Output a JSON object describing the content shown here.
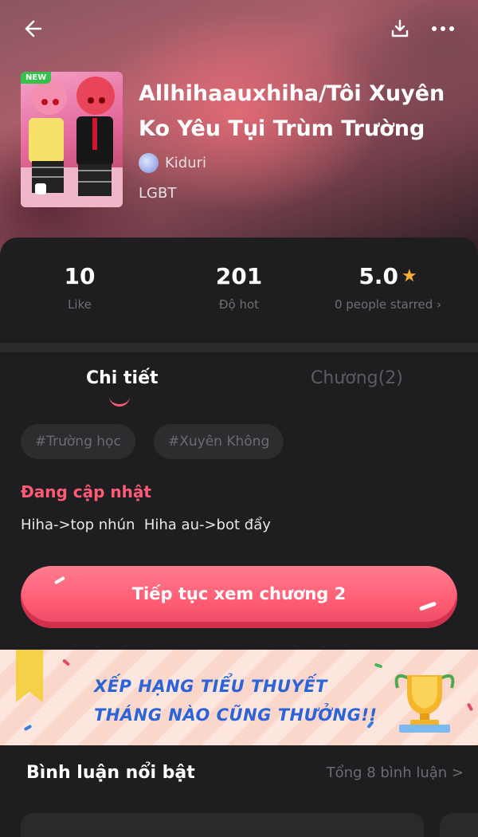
{
  "header": {
    "title": "Allhihaauxhiha/Tôi Xuyên Ko Yêu Tụi Trùm Trường",
    "author": "Kiduri",
    "genre": "LGBT",
    "cover_badge": "NEW"
  },
  "stats": [
    {
      "value": "10",
      "label": "Like"
    },
    {
      "value": "201",
      "label": "Độ hot"
    },
    {
      "value": "5.0",
      "label": "0 people starred"
    }
  ],
  "rating_chevron": "›",
  "tabs": {
    "detail": "Chi tiết",
    "chapters": "Chương(2)"
  },
  "tags": [
    "#Trường học",
    "#Xuyên Không"
  ],
  "status": "Đang cập nhật",
  "description": "Hiha->top nhún  Hiha au->bot đẩy",
  "cta": "Tiếp tục xem chương 2",
  "banner": {
    "line1": "XẾP HẠNG TIỂU THUYẾT",
    "line2": "THÁNG NÀO CŨNG THƯỞNG!!"
  },
  "comments": {
    "title": "Bình luận nổi bật",
    "count": "Tổng 8 bình luận >"
  },
  "colors": {
    "accent": "#ff5b77",
    "panel": "#1e1e20",
    "banner_text": "#2b63d9"
  },
  "icons": [
    "back-arrow-icon",
    "download-icon",
    "more-icon",
    "star-icon",
    "trophy-icon"
  ]
}
